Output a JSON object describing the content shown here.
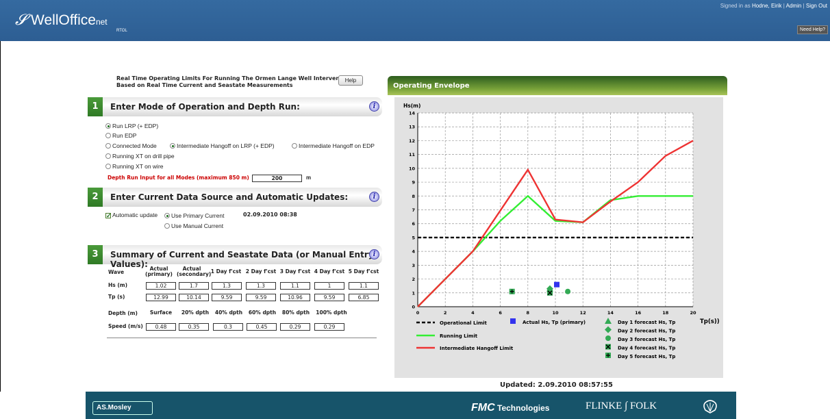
{
  "header": {
    "logo_main": "WellOffice",
    "logo_net": "net",
    "logo_sub": "RTOL",
    "signed_prefix": "Signed in as",
    "user": "Hodne, Eirik",
    "admin": "Admin",
    "signout": "Sign Out",
    "need_help": "Need Help?",
    "sep": "|"
  },
  "page": {
    "title_line1": "Real Time Operating Limits For Running The Ormen Lange Well Intervention",
    "title_line2": "Based on Real Time Current and Seastate Measurements",
    "help_button": "Help"
  },
  "section1": {
    "num": "1",
    "label": "Enter Mode of Operation and Depth Run:",
    "opt_lrp": "Run LRP (+ EDP)",
    "opt_edp": "Run EDP",
    "opt_connected": "Connected Mode",
    "opt_ih_lrp": "Intermediate Hangoff on LRP (+ EDP)",
    "opt_ih_edp": "Intermediate Hangoff on EDP",
    "opt_xt_drill": "Running XT on drill pipe",
    "opt_xt_wire": "Running XT on wire",
    "depth_label": "Depth Run Input for all Modes (maximum 850 m)",
    "depth_value": "200",
    "depth_unit": "m"
  },
  "section2": {
    "num": "2",
    "label": "Enter Current Data Source and Automatic Updates:",
    "auto_update": "Automatic update",
    "primary": "Use Primary Current",
    "manual": "Use Manual Current",
    "timestamp": "02.09.2010 08:38"
  },
  "section3": {
    "num": "3",
    "label": "Summary of Current and Seastate Data (or Manual Entry Values):",
    "wave_label": "Wave",
    "headers": [
      "Actual (primary)",
      "Actual (secondary)",
      "1 Day f'cst",
      "2 Day f'cst",
      "3 Day f'cst",
      "4 Day f'cst",
      "5 Day f'cst"
    ],
    "hs_label": "Hs (m)",
    "hs": [
      "1.02",
      "1.7",
      "1.3",
      "1.3",
      "1.1",
      "1",
      "1.1"
    ],
    "tp_label": "Tp (s)",
    "tp": [
      "12.99",
      "10.14",
      "9.59",
      "9.59",
      "10.96",
      "9.59",
      "6.85"
    ],
    "depth_label": "Depth (m)",
    "depth_headers": [
      "Surface",
      "20% dpth",
      "40% dpth",
      "60% dpth",
      "80% dpth",
      "100% dpth"
    ],
    "speed_label": "Speed (m/s)",
    "speed": [
      "0.48",
      "0.35",
      "0.3",
      "0.45",
      "0.29",
      "0.29"
    ]
  },
  "envelope": {
    "title": "Operating Envelope",
    "updated": "Updated: 2.09.2010 08:57:55"
  },
  "chart_data": {
    "type": "line",
    "ylabel": "Hs(m)",
    "xlabel": "Tp(s))",
    "xlim": [
      0,
      20
    ],
    "ylim": [
      0,
      14
    ],
    "xticks": [
      0,
      2,
      4,
      6,
      8,
      10,
      12,
      14,
      16,
      18,
      20
    ],
    "yticks": [
      0,
      1,
      2,
      3,
      4,
      5,
      6,
      7,
      8,
      9,
      10,
      11,
      12,
      13,
      14
    ],
    "grid": true,
    "operational_limit": {
      "name": "Operational Limit",
      "y": 5,
      "color": "#000000"
    },
    "series": [
      {
        "name": "Running Limit",
        "color": "#33ee33",
        "x": [
          0,
          4,
          6,
          8,
          10,
          12,
          14,
          16,
          18,
          20
        ],
        "y": [
          0,
          4,
          6.2,
          8,
          6.2,
          6.1,
          7.7,
          8,
          8,
          8
        ]
      },
      {
        "name": "Intermediate Hangoff Limit",
        "color": "#ee3333",
        "x": [
          0,
          4,
          8,
          10,
          12,
          14,
          16,
          18,
          20
        ],
        "y": [
          0,
          4,
          9.9,
          6.3,
          6.1,
          7.6,
          9,
          10.9,
          12
        ]
      }
    ],
    "points": [
      {
        "name": "Actual Hs, Tp (primary)",
        "marker": "square",
        "x": 10.1,
        "y": 1.6,
        "color": "#3333ee"
      },
      {
        "name": "Day 1 forecast Hs, Tp",
        "marker": "triangle",
        "x": 9.6,
        "y": 1.3,
        "color": "#33aa55"
      },
      {
        "name": "Day 2 forecast Hs, Tp",
        "marker": "diamond",
        "x": 9.6,
        "y": 1.3,
        "color": "#33aa55"
      },
      {
        "name": "Day 3 forecast Hs, Tp",
        "marker": "circle",
        "x": 10.9,
        "y": 1.1,
        "color": "#33aa55"
      },
      {
        "name": "Day 4 forecast Hs, Tp",
        "marker": "x",
        "x": 9.6,
        "y": 1.0,
        "color": "#33aa55"
      },
      {
        "name": "Day 5 forecast Hs, Tp",
        "marker": "plus",
        "x": 6.85,
        "y": 1.1,
        "color": "#33aa55"
      }
    ]
  },
  "footer": {
    "asmosley": "AS.Mosley",
    "fmc": "FMC",
    "technologies": "Technologies",
    "flinke": "FLINKE",
    "folk": "FOLK"
  }
}
